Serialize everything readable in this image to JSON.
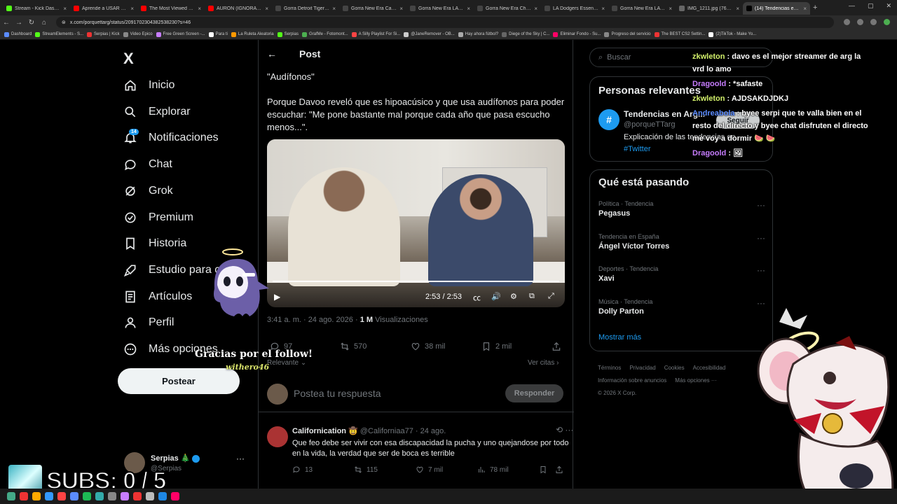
{
  "browser": {
    "tabs": [
      {
        "title": "Stream - Kick Dashbo...",
        "color": "#53fc18"
      },
      {
        "title": "Aprende a USAR GOR...",
        "color": "#ff0000"
      },
      {
        "title": "The Most Viewed VOD...",
        "color": "#ff0000"
      },
      {
        "title": "AURON (IGNORA a RE...",
        "color": "#ff0000"
      },
      {
        "title": "Gorra Detroit Tigers M...",
        "color": "#444444"
      },
      {
        "title": "Gorra New Era Carous...",
        "color": "#444444"
      },
      {
        "title": "Gorra New Era LA Dod...",
        "color": "#444444"
      },
      {
        "title": "Gorra New Era Chicag...",
        "color": "#444444"
      },
      {
        "title": "LA Dodgers Essential B...",
        "color": "#444444"
      },
      {
        "title": "Gorra New Era LA Dod...",
        "color": "#444444"
      },
      {
        "title": "IMG_1211.jpg (768×1...",
        "color": "#666666"
      },
      {
        "title": "(14) Tendencias en Arg...",
        "color": "#000000",
        "active": true
      }
    ],
    "url": "x.com/porquettarg/status/2091702304382538230?s=46",
    "bookmarks": [
      "Dashboard",
      "StreamElements - S...",
      "Serpias | Kick",
      "Video Epico",
      "Free Green Screen -...",
      "Para ti",
      "La Ruleta Aleatoria",
      "Serpias",
      "GrafMe - Fotomont...",
      "A Silly Playlist For Si...",
      "@JaneRemover - OB...",
      "Hay ahora fútbol?",
      "Diege of the Sky | C...",
      "Eliminar Fondo - Su...",
      "Progreso del servicio",
      "The BEST CS2 Settin...",
      "(2)TikTok - Make Yo..."
    ]
  },
  "sidebar": {
    "logo": "X",
    "items": [
      {
        "label": "Inicio",
        "icon": "home-icon"
      },
      {
        "label": "Explorar",
        "icon": "search-icon"
      },
      {
        "label": "Notificaciones",
        "icon": "bell-icon"
      },
      {
        "label": "Chat",
        "icon": "chat-icon"
      },
      {
        "label": "Grok",
        "icon": "grok-icon"
      },
      {
        "label": "Premium",
        "icon": "verified-icon"
      },
      {
        "label": "Historia",
        "icon": "bookmark-icon"
      },
      {
        "label": "Estudio para cr...",
        "icon": "rocket-icon"
      },
      {
        "label": "Artículos",
        "icon": "article-icon"
      },
      {
        "label": "Perfil",
        "icon": "person-icon"
      },
      {
        "label": "Más opciones",
        "icon": "more-circle-icon"
      }
    ],
    "notif_count": "14",
    "post_button": "Postear",
    "account": {
      "name": "Serpias 🎄",
      "handle": "@Serpias"
    }
  },
  "post": {
    "header": "Post",
    "line1": "\"Audífonos\"",
    "body": "Porque Davoo reveló que es hipoacúsico y que usa audífonos para poder escuchar: \"Me pone bastante mal porque cada año que pasa escucho menos...\".",
    "video_time": "2:53 / 2:53",
    "timestamp": "3:41 a. m. · 24 ago. 2026 · ",
    "views_count": "1 M",
    "views_label": " Visualizaciones",
    "stats": {
      "replies": "97",
      "reposts": "570",
      "likes": "38 mil",
      "bookmarks": "2 mil"
    },
    "sort_label": "Relevante",
    "quotes_label": "Ver citas",
    "reply_placeholder": "Postea tu respuesta",
    "reply_button": "Responder"
  },
  "reply": {
    "name": "Californication 🤠",
    "handle": "@Californiaa77 · 24 ago.",
    "text": "Que feo debe ser vivir con esa discapacidad la pucha y uno quejandose por todo en la vida, la verdad que ser de boca es terrible",
    "stats": {
      "replies": "13",
      "reposts": "115",
      "likes": "7 mil",
      "views": "78 mil"
    }
  },
  "right": {
    "search_placeholder": "Buscar",
    "people_title": "Personas relevantes",
    "person": {
      "name": "Tendencias en Arg...",
      "handle": "@porqueTTarg",
      "bio": "Explicación de las tendencias en...",
      "tag": "#Twitter",
      "follow": "Seguir"
    },
    "trends_title": "Qué está pasando",
    "trends": [
      {
        "context": "Política · Tendencia",
        "name": "Pegasus"
      },
      {
        "context": "Tendencia en España",
        "name": "Ángel Víctor Torres"
      },
      {
        "context": "Deportes · Tendencia",
        "name": "Xavi"
      },
      {
        "context": "Música · Tendencia",
        "name": "Dolly Parton"
      }
    ],
    "show_more": "Mostrar más",
    "footer": [
      "Términos",
      "Privacidad",
      "Cookies",
      "Accesibilidad",
      "Información sobre anuncios",
      "Más opciones ···",
      "© 2026 X Corp."
    ]
  },
  "overlay": {
    "chat": [
      {
        "user": "zkwleton",
        "color": "#d2f06b",
        "text": " : davo es el mejor streamer de arg la vrd lo amo"
      },
      {
        "user": "Dragoold",
        "color": "#c77dff",
        "text": " : *safaste"
      },
      {
        "user": "zkwleton",
        "color": "#d2f06b",
        "text": " : AJDSAKDJDKJ"
      },
      {
        "user": "Andreabola",
        "color": "#5b8cff",
        "text": " : byee serpi que te valla bien en el resto del directo y byee chat disfruten el directo me voy a dormir 🍉 🍉"
      },
      {
        "user": "Dragoold",
        "color": "#c77dff",
        "text": " : 🖼"
      }
    ],
    "follow_text": "Gracias por el follow!",
    "follow_user": "withero46",
    "subs": "SUBS: 0 / 5"
  }
}
